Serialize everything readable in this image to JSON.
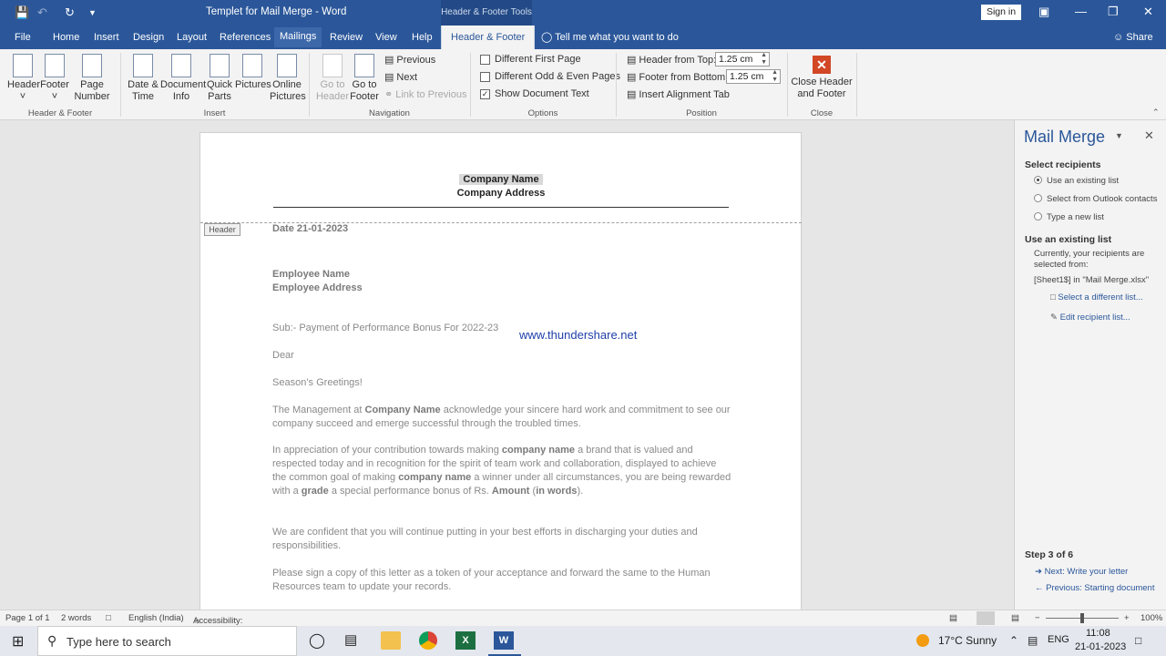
{
  "titlebar": {
    "title": "Templet for Mail Merge  -  Word",
    "context": "Header & Footer Tools",
    "signin": "Sign in"
  },
  "tabs": {
    "file": "File",
    "home": "Home",
    "insert": "Insert",
    "design": "Design",
    "layout": "Layout",
    "references": "References",
    "mailings": "Mailings",
    "review": "Review",
    "view": "View",
    "help": "Help",
    "header_footer": "Header & Footer",
    "tellme": "Tell me what you want to do",
    "share": "Share"
  },
  "ribbon": {
    "header": "Header",
    "footer": "Footer",
    "page_number": "Page Number",
    "grp_hf": "Header & Footer",
    "date_time": "Date & Time",
    "doc_info": "Document Info",
    "quick_parts": "Quick Parts",
    "pictures": "Pictures",
    "online_pictures": "Online Pictures",
    "grp_insert": "Insert",
    "goto_header": "Go to Header",
    "goto_footer": "Go to Footer",
    "previous": "Previous",
    "next": "Next",
    "link_prev": "Link to Previous",
    "grp_nav": "Navigation",
    "diff_first": "Different First Page",
    "diff_odd": "Different Odd & Even Pages",
    "show_doc": "Show Document Text",
    "grp_options": "Options",
    "hdr_top": "Header from Top:",
    "hdr_top_val": "1.25 cm",
    "ftr_bottom": "Footer from Bottom:",
    "ftr_bottom_val": "1.25 cm",
    "align_tab": "Insert Alignment Tab",
    "grp_position": "Position",
    "close_hf": "Close Header and Footer",
    "grp_close": "Close"
  },
  "document": {
    "company_name": "Company Name",
    "company_address": "Company Address",
    "header_tag": "Header",
    "date": "Date 21-01-2023",
    "emp_name": "Employee Name",
    "emp_address": "Employee Address",
    "subject": "Sub:-  Payment of Performance Bonus For 2022-23",
    "watermark": "www.thundershare.net",
    "dear": "Dear",
    "greeting": "Season’s Greetings!",
    "p1a": "The Management at ",
    "p1b": "Company Name",
    "p1c": " acknowledge your sincere hard work and commitment to see our company succeed and emerge successful through the troubled times.",
    "p2a": "In appreciation of your contribution towards making ",
    "p2b": "company name",
    "p2c": " a brand that is valued and respected today and in recognition for the spirit of team work and collaboration, displayed to achieve the common goal of making ",
    "p2d": "company name",
    "p2e": " a winner under all circumstances, you are being rewarded with a ",
    "p2f": "grade",
    "p2g": " a special performance bonus of Rs. ",
    "p2h": "Amount",
    "p2i": " (",
    "p2j": "in words",
    "p2k": ").",
    "p3": "We are confident that you will continue putting in your best efforts in discharging your duties and responsibilities.",
    "p4": "Please sign a copy of this letter as a token of your acceptance and forward the same to the Human Resources team to update your records."
  },
  "pane": {
    "title": "Mail Merge",
    "select_recipients": "Select recipients",
    "opt1": "Use an existing list",
    "opt2": "Select from Outlook contacts",
    "opt3": "Type a new list",
    "use_existing": "Use an existing list",
    "currently": "Currently, your recipients are selected from:",
    "source": "[Sheet1$] in \"Mail Merge.xlsx\"",
    "select_diff": "Select a different list...",
    "edit_list": "Edit recipient list...",
    "step": "Step 3 of 6",
    "next_step": "Next: Write your letter",
    "prev_step": "Previous: Starting document"
  },
  "status": {
    "page": "Page 1 of 1",
    "words": "2 words",
    "language": "English (India)",
    "accessibility": "Accessibility: Good to go",
    "zoom": "100%"
  },
  "taskbar": {
    "search": "Type here to search",
    "weather": "17°C  Sunny",
    "lang": "ENG",
    "time": "11:08",
    "date": "21-01-2023"
  }
}
